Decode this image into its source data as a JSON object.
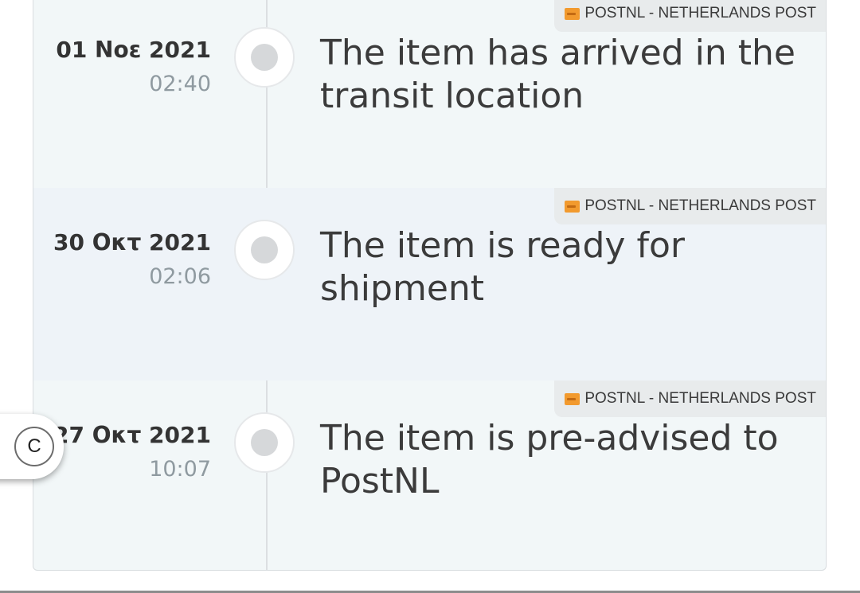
{
  "events": [
    {
      "carrier": "POSTNL - NETHERLANDS POST",
      "date": "01 Νοε 2021",
      "time": "02:40",
      "description": "The item has arrived in the transit location"
    },
    {
      "carrier": "POSTNL - NETHERLANDS POST",
      "date": "30 Οκτ 2021",
      "time": "02:06",
      "description": "The item is ready for shipment"
    },
    {
      "carrier": "POSTNL - NETHERLANDS POST",
      "date": "27 Οκτ 2021",
      "time": "10:07",
      "description": "The item is pre-advised to PostNL"
    }
  ],
  "side_button": {
    "label": "C"
  },
  "colors": {
    "card_bg": "#f2f7f8",
    "alt_row_bg": "#eef3f8",
    "carrier_tag_bg": "#e8ebec",
    "carrier_logo": "#f29a2e",
    "time_text": "#8f9aa0"
  },
  "icons": {
    "carrier_logo": "postnl-logo-icon",
    "timeline_node": "timeline-node-icon"
  }
}
